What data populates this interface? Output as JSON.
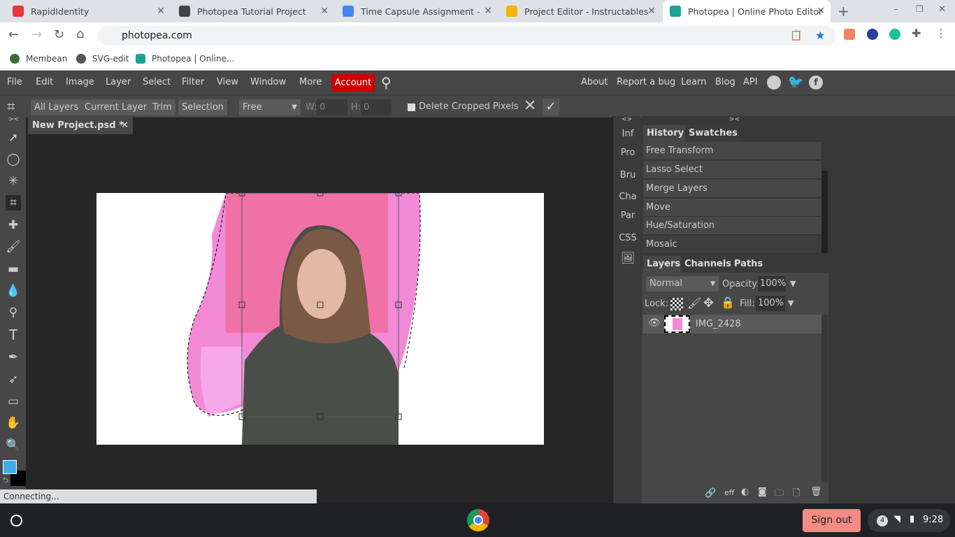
{
  "browser": {
    "tabs": [
      {
        "title": "RapidIdentity",
        "color": "#e53935"
      },
      {
        "title": "Photopea Tutorial Project",
        "color": "#444"
      },
      {
        "title": "Time Capsule Assignment - Goo",
        "color": "#4285f4"
      },
      {
        "title": "Project Editor - Instructables",
        "color": "#f5b400"
      },
      {
        "title": "Photopea | Online Photo Editor",
        "color": "#18a497",
        "active": true
      }
    ],
    "url": "photopea.com",
    "bookmarks": [
      "Membean",
      "SVG-edit",
      "Photopea | Online..."
    ]
  },
  "menu": {
    "items": [
      "File",
      "Edit",
      "Image",
      "Layer",
      "Select",
      "Filter",
      "View",
      "Window",
      "More"
    ],
    "account": "Account",
    "right": [
      "About",
      "Report a bug",
      "Learn",
      "Blog",
      "API"
    ]
  },
  "options": {
    "buttons": [
      "All Layers",
      "Current Layer",
      "Trim",
      "Selection"
    ],
    "ratio": "Free",
    "w_label": "W:",
    "w_value": "0",
    "h_label": "H:",
    "h_value": "0",
    "delete_cropped": "Delete Cropped Pixels",
    "delete_checked": false
  },
  "document": {
    "tab": "New Project.psd *"
  },
  "mini_panels": [
    "Inf",
    "Pro",
    "Bru",
    "Cha",
    "Par",
    "CSS"
  ],
  "history": {
    "tabs": [
      "History",
      "Swatches"
    ],
    "items": [
      "Free Transform",
      "Lasso Select",
      "Merge Layers",
      "Move",
      "Hue/Saturation",
      "Mosaic"
    ],
    "active_index": 5
  },
  "layers": {
    "tabs": [
      "Layers",
      "Channels",
      "Paths"
    ],
    "blend": "Normal",
    "opacity_label": "Opacity:",
    "opacity": "100%",
    "lock_label": "Lock:",
    "fill_label": "Fill:",
    "fill": "100%",
    "items": [
      {
        "name": "IMG_2428",
        "visible": true
      }
    ],
    "footer_eff": "eff"
  },
  "colors": {
    "foreground": "#3daee9",
    "background": "#000000",
    "accent": "#cc0000"
  },
  "status": "Connecting...",
  "taskbar": {
    "signout": "Sign out",
    "notifications": "4",
    "time": "9:28"
  }
}
